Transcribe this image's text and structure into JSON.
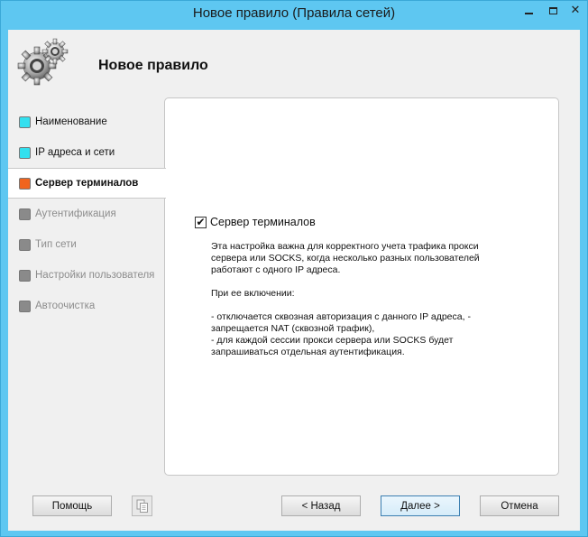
{
  "window": {
    "title": "Новое правило (Правила сетей)"
  },
  "header": {
    "title": "Новое правило",
    "icon": "gears-icon"
  },
  "nav": {
    "items": [
      {
        "label": "Наименование",
        "state": "done",
        "color": "#33e0ef"
      },
      {
        "label": "IP адреса и сети",
        "state": "done",
        "color": "#33e0ef"
      },
      {
        "label": "Сервер терминалов",
        "state": "current",
        "color": "#f0641e"
      },
      {
        "label": "Аутентификация",
        "state": "disabled",
        "color": "#8a8a8a"
      },
      {
        "label": "Тип сети",
        "state": "disabled",
        "color": "#8a8a8a"
      },
      {
        "label": "Настройки пользователя",
        "state": "disabled",
        "color": "#8a8a8a"
      },
      {
        "label": "Автоочистка",
        "state": "disabled",
        "color": "#8a8a8a"
      }
    ]
  },
  "content": {
    "checkbox_label": "Сервер терминалов",
    "checkbox_checked": true,
    "desc_line1": "Эта настройка важна для корректного учета трафика прокси",
    "desc_line2": "сервера или SOCKS, когда несколько разных пользователей",
    "desc_line3": "работают с одного IP адреса.",
    "desc_when": "При ее включении:",
    "desc_item1a": "- отключается сквозная авторизация с данного IP адреса, -",
    "desc_item1b": "запрещается NAT (сквозной трафик),",
    "desc_item2a": "- для каждой сессии прокси сервера или SOCKS будет",
    "desc_item2b": "запрашиваться отдельная аутентификация."
  },
  "buttons": {
    "help": "Помощь",
    "back": "< Назад",
    "next": "Далее >",
    "cancel": "Отмена"
  },
  "colors": {
    "titlebar": "#5ec7f1",
    "done": "#33e0ef",
    "current": "#f0641e",
    "disabled": "#8a8a8a"
  }
}
